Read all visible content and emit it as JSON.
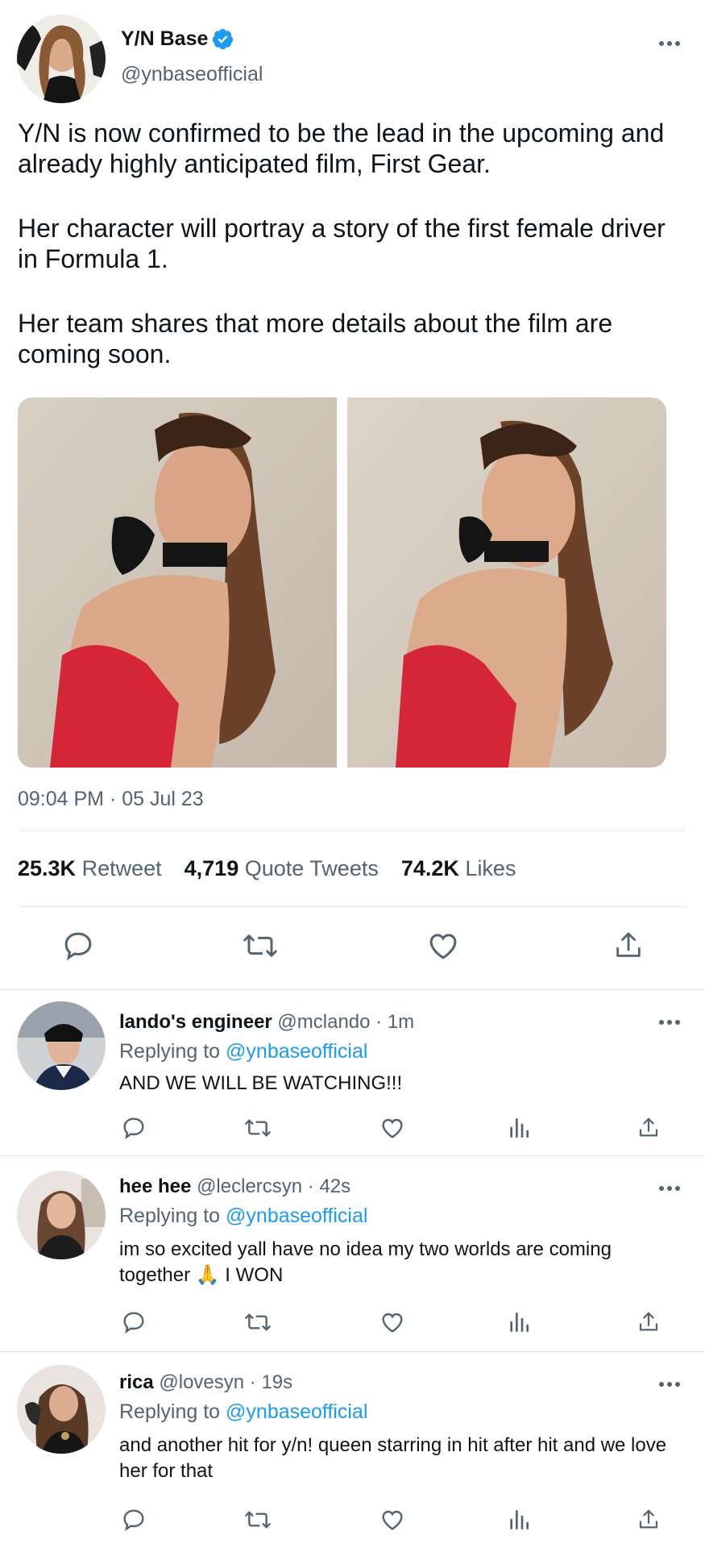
{
  "tweet": {
    "author_name": "Y/N Base",
    "handle": "@ynbaseofficial",
    "paragraphs": [
      "Y/N is now confirmed to be the lead in the upcoming and already highly anticipated film, First Gear.",
      "Her character will portray a story of the first female driver in Formula 1.",
      "Her team shares that more details about the film are coming soon."
    ],
    "timestamp": "09:04 PM · 05 Jul 23",
    "stats": {
      "retweets_count": "25.3K",
      "retweets_label": "Retweet",
      "quotes_count": "4,719",
      "quotes_label": "Quote Tweets",
      "likes_count": "74.2K",
      "likes_label": "Likes"
    },
    "icons": [
      "reply-icon",
      "retweet-icon",
      "like-icon",
      "share-icon"
    ]
  },
  "replies": [
    {
      "name": "lando's engineer",
      "handle": "@mclando · 1m",
      "replying_prefix": "Replying to",
      "replying_to": "@ynbaseofficial",
      "text": "AND WE WILL BE WATCHING!!!"
    },
    {
      "name": "hee hee",
      "handle": "@leclercsyn · 42s",
      "replying_prefix": "Replying to",
      "replying_to": "@ynbaseofficial",
      "text": "im so excited yall have no idea my two worlds are coming together 🙏 I WON"
    },
    {
      "name": "rica",
      "handle": "@lovesyn · 19s",
      "replying_prefix": "Replying to",
      "replying_to": "@ynbaseofficial",
      "text": "and another hit for y/n! queen starring in hit after hit and we love her for that"
    }
  ],
  "colors": {
    "accent": "#1d9bf0",
    "text_primary": "#0f1419",
    "text_secondary": "#536471",
    "divider": "#e4e8eb"
  }
}
